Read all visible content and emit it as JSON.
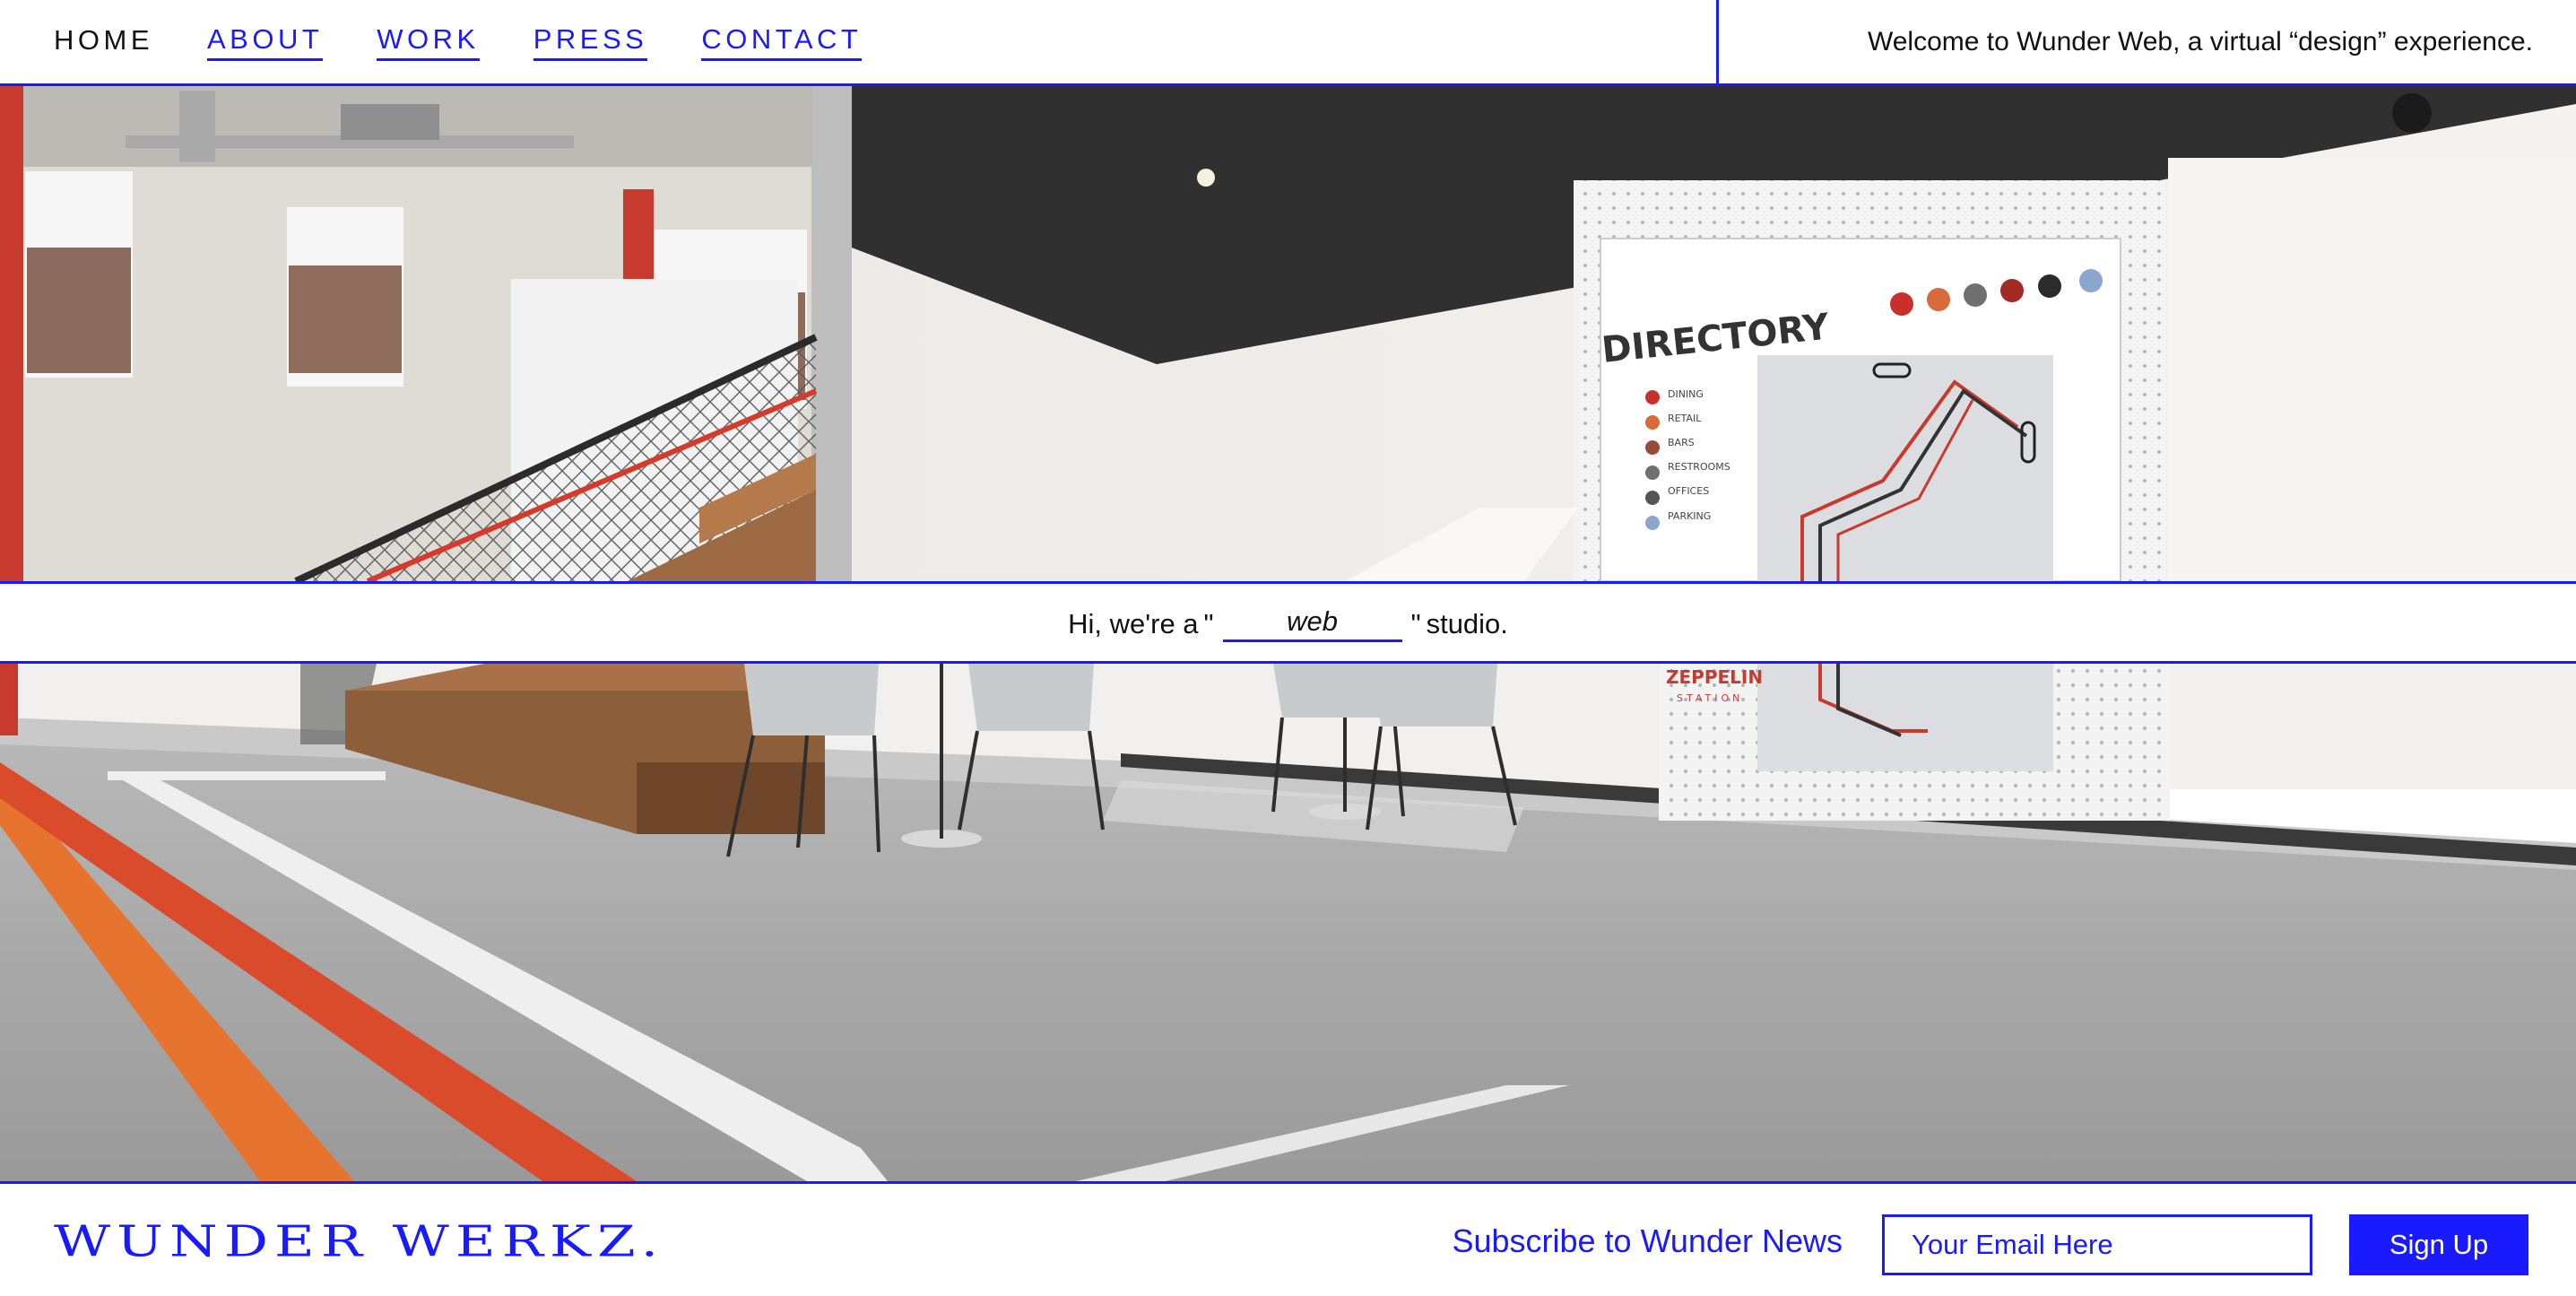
{
  "header": {
    "nav": [
      {
        "label": "HOME"
      },
      {
        "label": "ABOUT"
      },
      {
        "label": "WORK"
      },
      {
        "label": "PRESS"
      },
      {
        "label": "CONTACT"
      }
    ],
    "welcome": "Welcome to Wunder Web, a virtual “design” experience."
  },
  "hero": {
    "directory_sign": "DIRECTORY",
    "directory_items": [
      "DINING",
      "RETAIL",
      "BARS",
      "RESTROOMS",
      "OFFICES",
      "PARKING"
    ],
    "zeppelin_line1": "ZEPPELIN",
    "zeppelin_line2": "STATION"
  },
  "tagline": {
    "prefix": "Hi, we're a",
    "open_quote": "\"",
    "word": "web",
    "close_quote": "\"",
    "suffix": "studio."
  },
  "footer": {
    "logo": "WUNDER WERKZ.",
    "subscribe_label": "Subscribe to Wunder News",
    "email_placeholder": "Your Email Here",
    "signup_label": "Sign Up"
  },
  "colors": {
    "accent": "#1a1aff",
    "text": "#111111",
    "background": "#ffffff"
  },
  "icons": {
    "nav_divider": "vertical-rule"
  }
}
